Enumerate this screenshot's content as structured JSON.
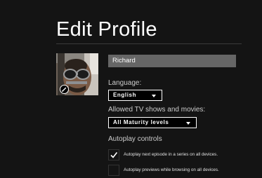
{
  "page": {
    "title": "Edit Profile"
  },
  "profile": {
    "name": "Richard",
    "avatar_icon": "profile-photo",
    "edit_icon": "pencil-icon"
  },
  "language": {
    "label": "Language:",
    "selected": "English"
  },
  "maturity": {
    "label": "Allowed TV shows and movies:",
    "selected": "All Maturity levels"
  },
  "autoplay": {
    "label": "Autoplay controls",
    "options": [
      {
        "text": "Autoplay next episode in a series on all devices.",
        "checked": true
      },
      {
        "text": "Autoplay previews while browsing on all devices.",
        "checked": false
      }
    ]
  },
  "colors": {
    "background": "#141414",
    "input_bg": "#666666",
    "text": "#cccccc"
  }
}
